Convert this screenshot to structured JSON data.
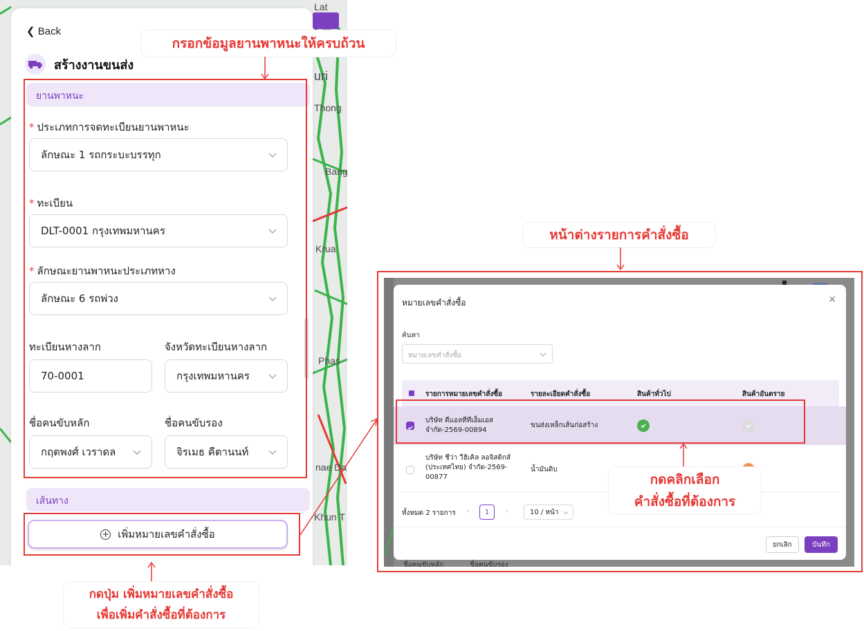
{
  "left_panel": {
    "back_label": "Back",
    "title": "สร้างงานขนส่ง",
    "vehicle_section": "ยานพาหนะ",
    "reg_type_label": "ประเภทการจดทะเบียนยานพาหนะ",
    "reg_type_value": "ลักษณะ 1 รถกระบะบรรทุก",
    "plate_label": "ทะเบียน",
    "plate_value": "DLT-0001 กรุงเทพมหานคร",
    "trailer_type_label": "ลักษณะยานพาหนะประเภทหาง",
    "trailer_type_value": "ลักษณะ 6 รถพ่วง",
    "trailer_plate_label": "ทะเบียนหางลาก",
    "trailer_plate_value": "70-0001",
    "trailer_province_label": "จังหวัดทะเบียนหางลาก",
    "trailer_province_value": "กรุงเทพมหานคร",
    "driver_main_label": "ชื่อคนขับหลัก",
    "driver_main_value": "กฤตพงศ์ เวราดล",
    "driver_sub_label": "ชื่อคนขับรอง",
    "driver_sub_value": "จิรเมธ คีตานนท์",
    "route_section": "เส้นทาง",
    "add_po_button": "เพิ่มหมายเลขคำสั่งซื้อ"
  },
  "map_labels": {
    "lat_lum": "Lat Lum Kae",
    "uri": "uri",
    "thong": "Thong",
    "bang": "Bang",
    "krua": "Krua",
    "phas": "Phas",
    "khun": "Khun T",
    "nae_da": "nae Da"
  },
  "annotations": {
    "fill_vehicle": "กรอกข้อมูลยานพาหนะให้ครบถ้วน",
    "click_add_line1": "กดปุ่ม เพิ่มหมายเลขคำสั่งซื้อ",
    "click_add_line2": "เพื่อเพิ่มคำสั่งซื้อที่ต้องการ",
    "po_window": "หน้าต่างรายการคำสั่งซื้อ",
    "select_line1": "กดคลิกเลือก",
    "select_line2": "คำสั่งซื้อที่ต้องการ"
  },
  "modal": {
    "title": "หมายเลขคำสั่งซื้อ",
    "search_label": "ค้นหา",
    "search_placeholder": "หมายเลขคำสั่งซื้อ",
    "columns": [
      "รายการหมายเลขคำสั่งซื้อ",
      "รายละเอียดคำสั่งซื้อ",
      "สินค้าทั่วไป",
      "สินค้าอันตราย"
    ],
    "rows": [
      {
        "order_line1": "บริษัท ดีแอลทีทีเอ็มเอส",
        "order_line2": "จำกัด-2569-00894",
        "detail": "ขนส่งเหล็กเส้นก่อสร้าง",
        "checked": true
      },
      {
        "order_line1": "บริษัท ชีว่า วีฮิเคิล ลอจิสติกส์",
        "order_line2": "(ประเทศไทย) จำกัด-2569-",
        "order_line3": "00877",
        "detail": "น้ำมันดิบ",
        "checked": false
      }
    ],
    "total_label": "ทั้งหมด 2 รายการ",
    "page": "1",
    "page_size": "10 / หน้า",
    "cancel": "ยกเลิก",
    "save": "บันทึก",
    "bottom_left_1": "ชื่อคนขับหลัก",
    "bottom_left_2": "ชื่อคนขับรอง"
  },
  "colors": {
    "accent": "#7b3fc0",
    "annotation": "#e53935",
    "check_green": "#4caf50",
    "danger_orange": "#f0915c"
  }
}
